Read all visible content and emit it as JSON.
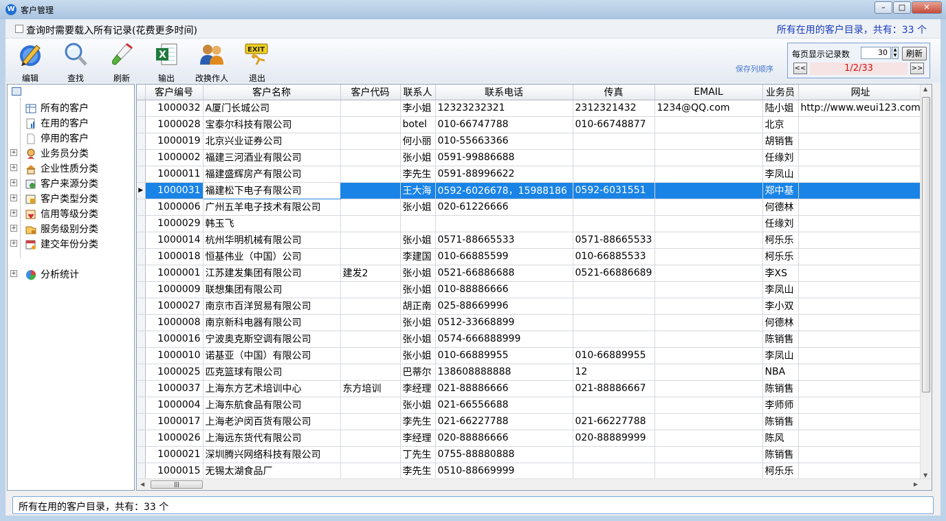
{
  "window": {
    "title": "客户管理",
    "app_icon": "W"
  },
  "query": {
    "checkbox_label": "查询时需要载入所有记录(花费更多时间)",
    "status": "所有在用的客户目录，共有：33 个"
  },
  "toolbar": {
    "edit": "编辑",
    "find": "查找",
    "refresh": "刷新",
    "export": "输出",
    "change_operator": "改换作人",
    "exit": "退出",
    "save_column_order": "保存列顺序"
  },
  "paging": {
    "per_page_label": "每页显示记录数",
    "per_page_value": "30",
    "refresh_button": "刷新",
    "prev": "<<",
    "next": ">>",
    "page_indicator": "1/2/33"
  },
  "tree": {
    "items": [
      {
        "label": "所有的客户",
        "icon": "grid-icon"
      },
      {
        "label": "在用的客户",
        "icon": "doc-chart-icon"
      },
      {
        "label": "停用的客户",
        "icon": "blank-doc-icon"
      },
      {
        "label": "业务员分类",
        "icon": "person-icon"
      },
      {
        "label": "企业性质分类",
        "icon": "house-icon"
      },
      {
        "label": "客户来源分类",
        "icon": "source-icon"
      },
      {
        "label": "客户类型分类",
        "icon": "type-icon"
      },
      {
        "label": "信用等级分类",
        "icon": "credit-icon"
      },
      {
        "label": "服务级别分类",
        "icon": "service-icon"
      },
      {
        "label": "建交年份分类",
        "icon": "calendar-icon"
      },
      {
        "label": "分析统计",
        "icon": "pie-chart-icon"
      }
    ]
  },
  "grid": {
    "columns": [
      "客户编号",
      "客户名称",
      "客户代码",
      "联系人",
      "联系电话",
      "传真",
      "EMAIL",
      "业务员",
      "网址"
    ],
    "selected_index": 5,
    "rows": [
      [
        "1000032",
        "A厦门长城公司",
        "",
        "李小姐",
        "12323232321",
        "2312321432",
        "1234@QQ.com",
        "陆小姐",
        "http://www.weui123.com"
      ],
      [
        "1000028",
        "宝泰尔科技有限公司",
        "",
        "botel",
        "010-66747788",
        "010-66748877",
        "",
        "北京",
        ""
      ],
      [
        "1000019",
        "北京兴业证券公司",
        "",
        "何小丽",
        "010-55663366",
        "",
        "",
        "胡销售",
        ""
      ],
      [
        "1000002",
        "福建三河酒业有限公司",
        "",
        "张小姐",
        "0591-99886688",
        "",
        "",
        "任缘刘",
        ""
      ],
      [
        "1000011",
        "福建盛辉房产有限公司",
        "",
        "李先生",
        "0591-88996622",
        "",
        "",
        "李凤山",
        ""
      ],
      [
        "1000031",
        "福建松下电子有限公司",
        "",
        "王大海",
        "0592-6026678，15988186",
        "0592-6031551",
        "",
        "郑中基",
        ""
      ],
      [
        "1000006",
        "广州五羊电子技术有限公司",
        "",
        "张小姐",
        "020-61226666",
        "",
        "",
        "何德林",
        ""
      ],
      [
        "1000029",
        "韩玉飞",
        "",
        "",
        "",
        "",
        "",
        "任缘刘",
        ""
      ],
      [
        "1000014",
        "杭州华明机械有限公司",
        "",
        "张小姐",
        "0571-88665533",
        "0571-88665533",
        "",
        "柯乐乐",
        ""
      ],
      [
        "1000018",
        "恒基伟业（中国）公司",
        "",
        "李建国",
        "010-66885599",
        "010-66885533",
        "",
        "柯乐乐",
        ""
      ],
      [
        "1000001",
        "江苏建发集团有限公司",
        "建发2",
        "张小姐",
        "0521-66886688",
        "0521-66886689",
        "",
        "李XS",
        ""
      ],
      [
        "1000009",
        "联想集团有限公司",
        "",
        "张小姐",
        "010-88886666",
        "",
        "",
        "李凤山",
        ""
      ],
      [
        "1000027",
        "南京市百洋贸易有限公司",
        "",
        "胡正南",
        "025-88669996",
        "",
        "",
        "李小双",
        ""
      ],
      [
        "1000008",
        "南京新科电器有限公司",
        "",
        "张小姐",
        "0512-33668899",
        "",
        "",
        "何德林",
        ""
      ],
      [
        "1000016",
        "宁波奥克斯空调有限公司",
        "",
        "张小姐",
        "0574-666888999",
        "",
        "",
        "陈销售",
        ""
      ],
      [
        "1000010",
        "诺基亚（中国）有限公司",
        "",
        "张小姐",
        "010-66889955",
        "010-66889955",
        "",
        "李凤山",
        ""
      ],
      [
        "1000025",
        "匹克篮球有限公司",
        "",
        "巴蒂尔",
        "138608888888",
        "12",
        "",
        "NBA",
        ""
      ],
      [
        "1000037",
        "上海东方艺术培训中心",
        "东方培训",
        "李经理",
        "021-88886666",
        "021-88886667",
        "",
        "陈销售",
        ""
      ],
      [
        "1000004",
        "上海东航食品有限公司",
        "",
        "张小姐",
        "021-66556688",
        "",
        "",
        "李师师",
        ""
      ],
      [
        "1000017",
        "上海老沪闵百货有限公司",
        "",
        "李先生",
        "021-66227788",
        "021-66227788",
        "",
        "陈销售",
        ""
      ],
      [
        "1000026",
        "上海远东货代有限公司",
        "",
        "李经理",
        "020-88886666",
        "020-88889999",
        "",
        "陈风",
        ""
      ],
      [
        "1000021",
        "深圳腾兴网络科技有限公司",
        "",
        "丁先生",
        "0755-88880888",
        "",
        "",
        "陈销售",
        ""
      ],
      [
        "1000015",
        "无锡太湖食品厂",
        "",
        "李先生",
        "0510-88669999",
        "",
        "",
        "柯乐乐",
        ""
      ]
    ]
  },
  "statusbar": {
    "text": "所有在用的客户目录，共有：33 个"
  }
}
